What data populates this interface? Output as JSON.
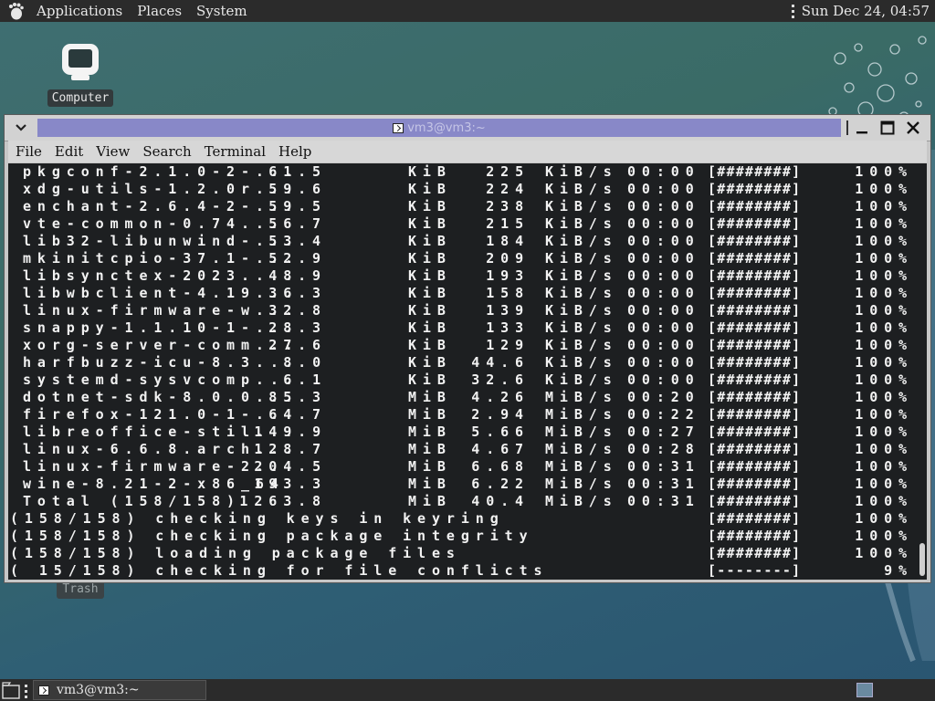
{
  "top_panel": {
    "menus": [
      "Applications",
      "Places",
      "System"
    ],
    "clock": "Sun Dec 24, 04:57"
  },
  "desktop": {
    "computer_label": "Computer",
    "trash_label": "Trash"
  },
  "window": {
    "title": "vm3@vm3:~",
    "menus": [
      "File",
      "Edit",
      "View",
      "Search",
      "Terminal",
      "Help"
    ]
  },
  "downloads": [
    {
      "name": "pkgconf-2.1.0-2-...",
      "size": "61.5",
      "size_unit": "KiB",
      "rate": "225",
      "rate_unit": "KiB/s",
      "time": "00:00",
      "bar": "[########]",
      "pct": "100%"
    },
    {
      "name": "xdg-utils-1.2.0r...",
      "size": "59.6",
      "size_unit": "KiB",
      "rate": "224",
      "rate_unit": "KiB/s",
      "time": "00:00",
      "bar": "[########]",
      "pct": "100%"
    },
    {
      "name": "enchant-2.6.4-2-...",
      "size": "59.5",
      "size_unit": "KiB",
      "rate": "238",
      "rate_unit": "KiB/s",
      "time": "00:00",
      "bar": "[########]",
      "pct": "100%"
    },
    {
      "name": "vte-common-0.74...",
      "size": "56.7",
      "size_unit": "KiB",
      "rate": "215",
      "rate_unit": "KiB/s",
      "time": "00:00",
      "bar": "[########]",
      "pct": "100%"
    },
    {
      "name": "lib32-libunwind-...",
      "size": "53.4",
      "size_unit": "KiB",
      "rate": "184",
      "rate_unit": "KiB/s",
      "time": "00:00",
      "bar": "[########]",
      "pct": "100%"
    },
    {
      "name": "mkinitcpio-37.1-...",
      "size": "52.9",
      "size_unit": "KiB",
      "rate": "209",
      "rate_unit": "KiB/s",
      "time": "00:00",
      "bar": "[########]",
      "pct": "100%"
    },
    {
      "name": "libsynctex-2023....",
      "size": "48.9",
      "size_unit": "KiB",
      "rate": "193",
      "rate_unit": "KiB/s",
      "time": "00:00",
      "bar": "[########]",
      "pct": "100%"
    },
    {
      "name": "libwbclient-4.19...",
      "size": "36.3",
      "size_unit": "KiB",
      "rate": "158",
      "rate_unit": "KiB/s",
      "time": "00:00",
      "bar": "[########]",
      "pct": "100%"
    },
    {
      "name": "linux-firmware-w...",
      "size": "32.8",
      "size_unit": "KiB",
      "rate": "139",
      "rate_unit": "KiB/s",
      "time": "00:00",
      "bar": "[########]",
      "pct": "100%"
    },
    {
      "name": "snappy-1.1.10-1-...",
      "size": "28.3",
      "size_unit": "KiB",
      "rate": "133",
      "rate_unit": "KiB/s",
      "time": "00:00",
      "bar": "[########]",
      "pct": "100%"
    },
    {
      "name": "xorg-server-comm...",
      "size": "27.6",
      "size_unit": "KiB",
      "rate": "129",
      "rate_unit": "KiB/s",
      "time": "00:00",
      "bar": "[########]",
      "pct": "100%"
    },
    {
      "name": "harfbuzz-icu-8.3...",
      "size": "8.0",
      "size_unit": "KiB",
      "rate": "44.6",
      "rate_unit": "KiB/s",
      "time": "00:00",
      "bar": "[########]",
      "pct": "100%"
    },
    {
      "name": "systemd-sysvcomp...",
      "size": "6.1",
      "size_unit": "KiB",
      "rate": "32.6",
      "rate_unit": "KiB/s",
      "time": "00:00",
      "bar": "[########]",
      "pct": "100%"
    },
    {
      "name": "dotnet-sdk-8.0.0...",
      "size": "85.3",
      "size_unit": "MiB",
      "rate": "4.26",
      "rate_unit": "MiB/s",
      "time": "00:20",
      "bar": "[########]",
      "pct": "100%"
    },
    {
      "name": "firefox-121.0-1-...",
      "size": "64.7",
      "size_unit": "MiB",
      "rate": "2.94",
      "rate_unit": "MiB/s",
      "time": "00:22",
      "bar": "[########]",
      "pct": "100%"
    },
    {
      "name": "libreoffice-stil...",
      "size": "149.9",
      "size_unit": "MiB",
      "rate": "5.66",
      "rate_unit": "MiB/s",
      "time": "00:27",
      "bar": "[########]",
      "pct": "100%"
    },
    {
      "name": "linux-6.6.8.arch...",
      "size": "128.7",
      "size_unit": "MiB",
      "rate": "4.67",
      "rate_unit": "MiB/s",
      "time": "00:28",
      "bar": "[########]",
      "pct": "100%"
    },
    {
      "name": "linux-firmware-2...",
      "size": "204.5",
      "size_unit": "MiB",
      "rate": "6.68",
      "rate_unit": "MiB/s",
      "time": "00:31",
      "bar": "[########]",
      "pct": "100%"
    },
    {
      "name": "wine-8.21-2-x86_64",
      "size": "193.3",
      "size_unit": "MiB",
      "rate": "6.22",
      "rate_unit": "MiB/s",
      "time": "00:31",
      "bar": "[########]",
      "pct": "100%"
    },
    {
      "name": "Total (158/158)",
      "size": "1263.8",
      "size_unit": "MiB",
      "rate": "40.4",
      "rate_unit": "MiB/s",
      "time": "00:31",
      "bar": "[########]",
      "pct": "100%"
    }
  ],
  "steps": [
    {
      "text": "(158/158) checking keys in keyring",
      "bar": "[########]",
      "pct": "100%"
    },
    {
      "text": "(158/158) checking package integrity",
      "bar": "[########]",
      "pct": "100%"
    },
    {
      "text": "(158/158) loading package files",
      "bar": "[########]",
      "pct": "100%"
    },
    {
      "text": "( 15/158) checking for file conflicts",
      "bar": "[--------]",
      "pct": "9%"
    }
  ],
  "bottom_panel": {
    "task_label": "vm3@vm3:~"
  },
  "colors": {
    "panel": "#2b2b2b",
    "title_active": "#8888c8",
    "terminal_bg": "#1d1f21",
    "terminal_fg": "#f2f2f2"
  }
}
